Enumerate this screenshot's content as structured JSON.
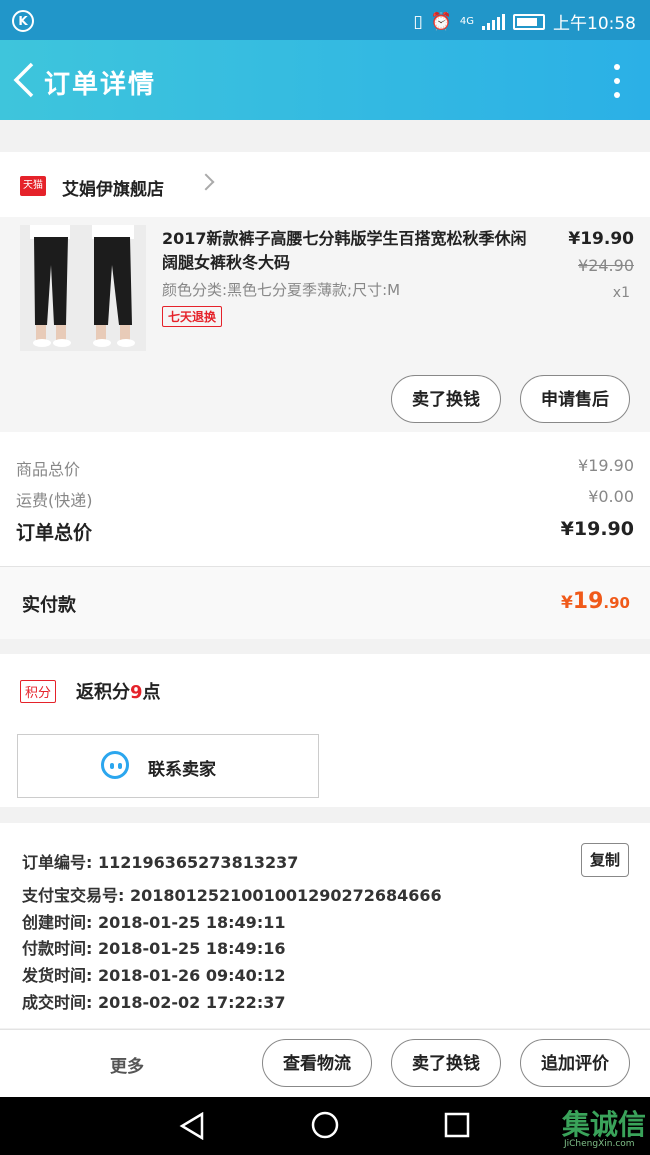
{
  "status_bar": {
    "carrier_icon": "K",
    "network": "4G",
    "time": "上午10:58"
  },
  "header": {
    "title": "订单详情"
  },
  "shop": {
    "badge": "天猫",
    "name": "艾娟伊旗舰店"
  },
  "product": {
    "title": "2017新款裤子高腰七分韩版学生百搭宽松秋季休闲阔腿女裤秋冬大码",
    "spec": "颜色分类:黑色七分夏季薄款;尺寸:M",
    "tag": "七天退换",
    "price": "¥19.90",
    "original_price": "¥24.90",
    "quantity": "x1",
    "btn_exchange": "卖了换钱",
    "btn_aftersale": "申请售后"
  },
  "summary": {
    "goods_total_label": "商品总价",
    "goods_total": "¥19.90",
    "shipping_label": "运费(快递)",
    "shipping": "¥0.00",
    "order_total_label": "订单总价",
    "order_total": "¥19.90"
  },
  "paid": {
    "label": "实付款",
    "currency": "¥",
    "int": "19",
    "dec": ".90"
  },
  "points": {
    "badge": "积分",
    "prefix": "返积分",
    "value": "9",
    "suffix": "点"
  },
  "contact": {
    "label": "联系卖家"
  },
  "order_info": {
    "order_no": "订单编号: 112196365273813237",
    "alipay_no": "支付宝交易号: 2018012521001001290272684666",
    "created": "创建时间: 2018-01-25 18:49:11",
    "paid": "付款时间: 2018-01-25 18:49:16",
    "shipped": "发货时间: 2018-01-26 09:40:12",
    "completed": "成交时间: 2018-02-02 17:22:37",
    "copy": "复制"
  },
  "bottom": {
    "more": "更多",
    "logistics": "查看物流",
    "exchange": "卖了换钱",
    "review": "追加评价"
  },
  "watermark": {
    "brand": "集诚信",
    "site": "JiChengXin.com"
  },
  "colors": {
    "accent_orange": "#f05a1a",
    "tmall_red": "#e5222a",
    "appbar": "#2bb0e6"
  }
}
